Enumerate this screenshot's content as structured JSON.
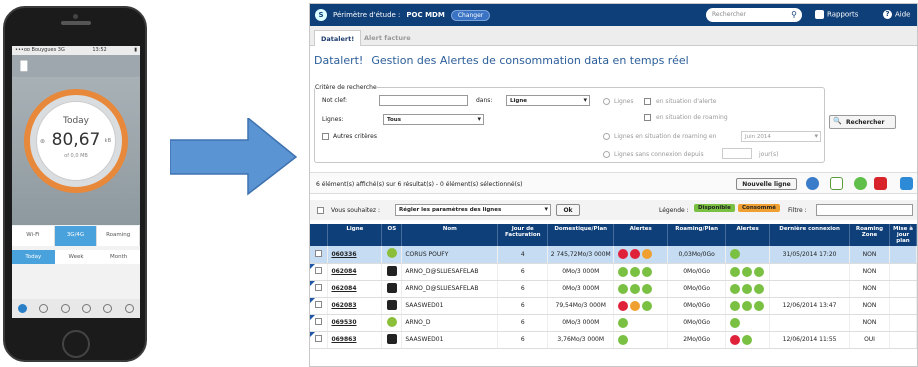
{
  "phone": {
    "carrier": "•••oo Bouygues 3G",
    "time": "13:52",
    "battery": "▮",
    "today_label": "Today",
    "value": "80,67",
    "unit": "kB",
    "sub": "of 0,0 MB",
    "tabs": [
      "Wi-Fi",
      "3G/4G",
      "Roaming"
    ],
    "periods": [
      "Today",
      "Week",
      "Month"
    ]
  },
  "app": {
    "perimeter_label": "Périmètre d'étude :",
    "perimeter_value": "POC MDM",
    "change_label": "Changer",
    "search_placeholder": "Rechercher",
    "reports_label": "Rapports",
    "help_label": "Aide",
    "tabs": [
      "Datalert!",
      "Alert facture"
    ],
    "title_a": "Datalert!",
    "title_b": "Gestion des Alertes de consommation data en temps réel",
    "criteria": {
      "legend": "Critère de recherche",
      "nocle_label": "Not clef:",
      "dans_label": "dans:",
      "dans_value": "Ligne",
      "lignes_label": "Lignes:",
      "lignes_value": "Tous",
      "autres_label": "Autres critères",
      "opt1": "Lignes",
      "opt1a": "en situation d'alerte",
      "opt1b": "en situation de roaming",
      "opt2": "Lignes en situation de roaming en",
      "opt2_value": "Juin 2014",
      "opt3": "Lignes sans connexion depuis",
      "opt3_unit": "jour(s)"
    },
    "search_button": "Rechercher",
    "count_text": "6 élément(s) affiché(s) sur 6 résultat(s)  -  0 élément(s) sélectionné(s)",
    "new_line_button": "Nouvelle ligne",
    "wish_label": "Vous souhaitez :",
    "wish_value": "Régler les paramètres des lignes",
    "ok_label": "Ok",
    "legend_label": "Légende :",
    "legend_items": [
      {
        "label": "Disponible",
        "color": "#79c043"
      },
      {
        "label": "Consommé",
        "color": "#f0a030"
      }
    ],
    "filter_label": "Filtre :",
    "columns": [
      "Ligne",
      "OS",
      "Nom",
      "Jour de Facturation",
      "Domestique/Plan",
      "Alertes",
      "Roaming/Plan",
      "Alertes",
      "Dernière connexion",
      "Roaming Zone",
      "Mise à jour plan"
    ],
    "rows": [
      {
        "ligne": "060336",
        "os": "android",
        "nom": "CORUS POUFY",
        "jour": "4",
        "dom": "2 745,72Mo/3 000M",
        "alerts1": [
          "r",
          "r",
          "o"
        ],
        "roam": "0,03Mo/0Go",
        "alerts2": [
          "g"
        ],
        "last": "31/05/2014 17:20",
        "zone": "NON",
        "sel": true
      },
      {
        "ligne": "062084",
        "os": "ios",
        "nom": "ARNO_D@SLUESAFELAB",
        "jour": "6",
        "dom": "0Mo/3 000M",
        "alerts1": [
          "g",
          "g",
          "g"
        ],
        "roam": "0Mo/0Go",
        "alerts2": [
          "g",
          "g",
          "g"
        ],
        "last": "",
        "zone": "NON",
        "sel": false
      },
      {
        "ligne": "062084",
        "os": "ios",
        "nom": "ARNO_D@SLUESAFELAB",
        "jour": "6",
        "dom": "0Mo/3 000M",
        "alerts1": [
          "g",
          "g",
          "g"
        ],
        "roam": "0Mo/0Go",
        "alerts2": [
          "g",
          "g",
          "g"
        ],
        "last": "",
        "zone": "NON",
        "sel": false
      },
      {
        "ligne": "062083",
        "os": "ios",
        "nom": "SAASWED01",
        "jour": "6",
        "dom": "79,54Mo/3 000M",
        "alerts1": [
          "r",
          "o",
          "g"
        ],
        "roam": "0Mo/0Go",
        "alerts2": [
          "g",
          "g",
          "g"
        ],
        "last": "12/06/2014 13:47",
        "zone": "NON",
        "sel": false
      },
      {
        "ligne": "069530",
        "os": "android",
        "nom": "ARNO_D",
        "jour": "6",
        "dom": "0Mo/3 000M",
        "alerts1": [
          "g"
        ],
        "roam": "0Mo/0Go",
        "alerts2": [
          "g"
        ],
        "last": "",
        "zone": "NON",
        "sel": false
      },
      {
        "ligne": "069863",
        "os": "ios",
        "nom": "SAASWED01",
        "jour": "6",
        "dom": "3,76Mo/3 000M",
        "alerts1": [
          "g"
        ],
        "roam": "2Mo/0Go",
        "alerts2": [
          "r",
          "g"
        ],
        "last": "12/06/2014 11:55",
        "zone": "OUI",
        "sel": false
      }
    ]
  }
}
